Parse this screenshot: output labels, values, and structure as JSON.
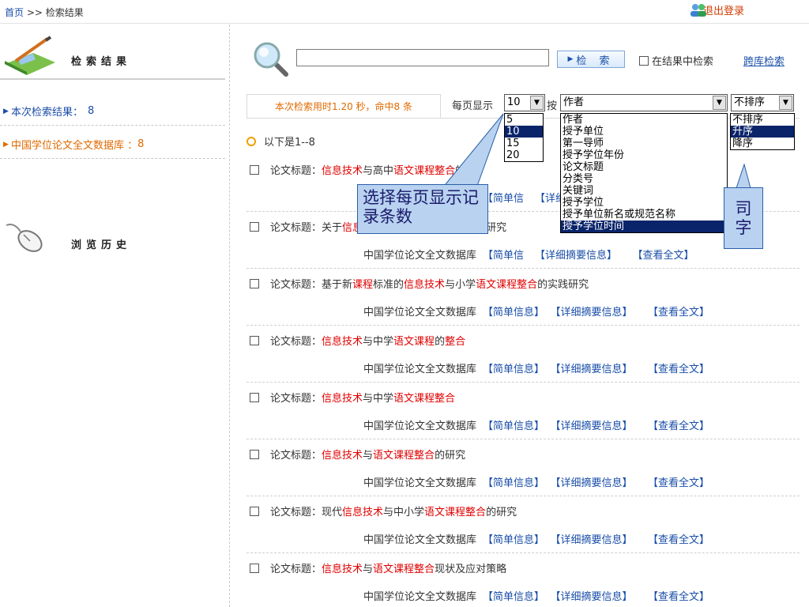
{
  "header": {
    "home": "首页",
    "sep": ">>",
    "current": "检索结果",
    "logout": "退出登录"
  },
  "left": {
    "result_title": "检索结果",
    "history_title": "浏览历史",
    "rows": [
      {
        "label": "本次检索结果：",
        "count": "8"
      },
      {
        "label": "中国学位论文全文数据库 ：",
        "count": "8"
      }
    ]
  },
  "search": {
    "value": "",
    "button": "检 索",
    "in_result": "在结果中检索",
    "cross": "跨库检索"
  },
  "stats": {
    "text": "本次检索用时1.20 秒，命中8 条",
    "per_page_label": "每页显示",
    "per_page_value": "10",
    "per_page_options": [
      "5",
      "10",
      "15",
      "20"
    ],
    "sort_label": "按",
    "sort_value": "作者",
    "sort_options": [
      "作者",
      "授予单位",
      "第一导师",
      "授予学位年份",
      "论文标题",
      "分类号",
      "关键词",
      "授予学位",
      "授予单位新名或规范名称",
      "授予学位时间"
    ],
    "order_value": "不排序",
    "order_options": [
      "不排序",
      "升序",
      "降序"
    ],
    "range": "以下是1--8",
    "hidden_text": "选"
  },
  "results": [
    {
      "prefix": "论文标题：",
      "parts": [
        [
          "信息技术",
          "r"
        ],
        [
          "与高中",
          ""
        ],
        [
          "语文",
          "r"
        ],
        [
          "课程整合",
          "r"
        ],
        [
          "的教",
          ""
        ]
      ]
    },
    {
      "prefix": "论文标题：关于",
      "parts": [
        [
          "信息技术",
          "r"
        ],
        [
          "与中学",
          ""
        ],
        [
          "语文课程整合",
          "r"
        ],
        [
          "的研究",
          ""
        ]
      ]
    },
    {
      "prefix": "论文标题：基于新",
      "parts": [
        [
          "课程",
          "r"
        ],
        [
          "标准的",
          ""
        ],
        [
          "信息技术",
          "r"
        ],
        [
          "与小学",
          ""
        ],
        [
          "语文课程整合",
          "r"
        ],
        [
          "的实践研究",
          ""
        ]
      ]
    },
    {
      "prefix": "论文标题：",
      "parts": [
        [
          "信息技术",
          "r"
        ],
        [
          "与中学",
          ""
        ],
        [
          "语文课程",
          "r"
        ],
        [
          "的",
          ""
        ],
        [
          "整合",
          "r"
        ]
      ]
    },
    {
      "prefix": "论文标题：",
      "parts": [
        [
          "信息技术",
          "r"
        ],
        [
          "与中学",
          ""
        ],
        [
          "语文课程整合",
          "r"
        ]
      ]
    },
    {
      "prefix": "论文标题：",
      "parts": [
        [
          "信息技术",
          "r"
        ],
        [
          "与",
          ""
        ],
        [
          "语文课程整合",
          "r"
        ],
        [
          "的研究",
          ""
        ]
      ]
    },
    {
      "prefix": "论文标题：现代",
      "parts": [
        [
          "信息技术",
          "r"
        ],
        [
          "与中小学",
          ""
        ],
        [
          "语文课程整合",
          "r"
        ],
        [
          "的研究",
          ""
        ]
      ]
    },
    {
      "prefix": "论文标题：",
      "parts": [
        [
          "信息技术",
          "r"
        ],
        [
          "与",
          ""
        ],
        [
          "语文课程整合",
          "r"
        ],
        [
          "现状及应对策略",
          ""
        ]
      ]
    }
  ],
  "result_links": {
    "db": "中国学位论文全文数据库",
    "brief": "【简单信息】",
    "detail": "【详细摘要信息】",
    "full": "【查看全文】",
    "brief_cut": "【简单信"
  },
  "callouts": {
    "per_page_note": "选择每页显示记录条数",
    "field_note": "司 字"
  },
  "colors": {
    "link": "#1a4ea8",
    "accent": "#e06a00",
    "highlight": "#e00000",
    "callout": "#b8d2f0"
  }
}
